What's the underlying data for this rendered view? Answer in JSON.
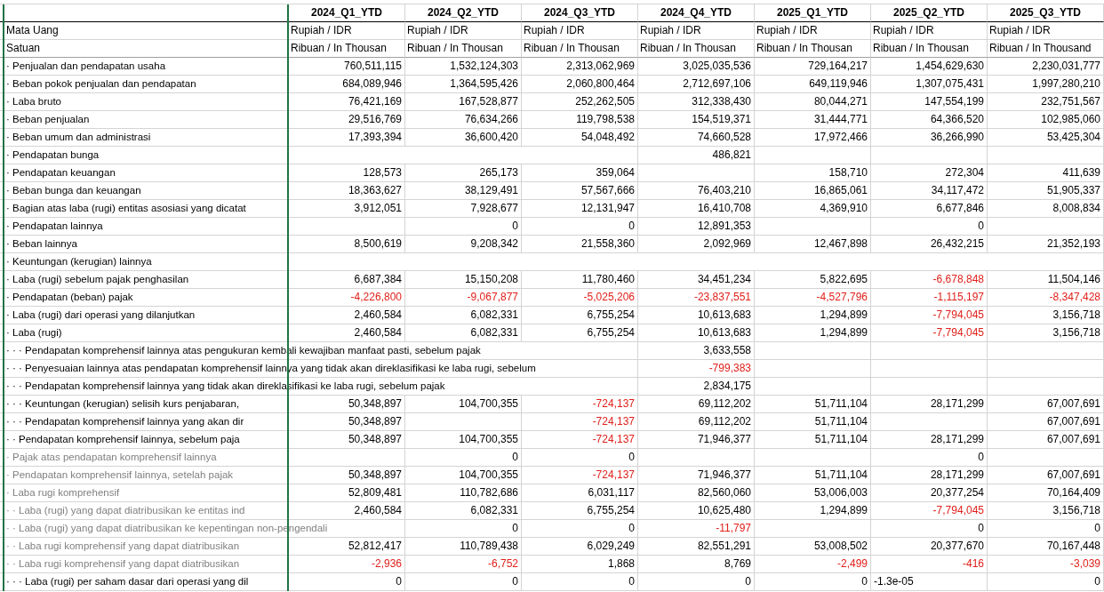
{
  "columns": [
    "2024_Q1_YTD",
    "2024_Q2_YTD",
    "2024_Q3_YTD",
    "2024_Q4_YTD",
    "2025_Q1_YTD",
    "2025_Q2_YTD",
    "2025_Q3_YTD"
  ],
  "currency": {
    "label": "Mata Uang",
    "values": [
      "Rupiah / IDR",
      "Rupiah / IDR",
      "Rupiah / IDR",
      "Rupiah / IDR",
      "Rupiah / IDR",
      "Rupiah / IDR",
      "Rupiah / IDR"
    ]
  },
  "unit": {
    "label": "Satuan",
    "values": [
      "Ribuan / In Thousan",
      "Ribuan / In Thousan",
      "Ribuan / In Thousan",
      "Ribuan / In Thousan",
      "Ribuan / In Thousan",
      "Ribuan / In Thousan",
      "Ribuan / In Thousand"
    ]
  },
  "rows": [
    {
      "label": "· Penjualan dan pendapatan usaha",
      "dimmed": false,
      "cells": [
        {
          "value": "760,511,115",
          "negative": false
        },
        {
          "value": "1,532,124,303",
          "negative": false
        },
        {
          "value": "2,313,062,969",
          "negative": false
        },
        {
          "value": "3,025,035,536",
          "negative": false
        },
        {
          "value": "729,164,217",
          "negative": false
        },
        {
          "value": "1,454,629,630",
          "negative": false
        },
        {
          "value": "2,230,031,777",
          "negative": false
        }
      ]
    },
    {
      "label": "· Beban pokok penjualan dan pendapatan",
      "dimmed": false,
      "cells": [
        {
          "value": "684,089,946",
          "negative": false
        },
        {
          "value": "1,364,595,426",
          "negative": false
        },
        {
          "value": "2,060,800,464",
          "negative": false
        },
        {
          "value": "2,712,697,106",
          "negative": false
        },
        {
          "value": "649,119,946",
          "negative": false
        },
        {
          "value": "1,307,075,431",
          "negative": false
        },
        {
          "value": "1,997,280,210",
          "negative": false
        }
      ]
    },
    {
      "label": "· Laba bruto",
      "dimmed": false,
      "cells": [
        {
          "value": "76,421,169",
          "negative": false
        },
        {
          "value": "167,528,877",
          "negative": false
        },
        {
          "value": "252,262,505",
          "negative": false
        },
        {
          "value": "312,338,430",
          "negative": false
        },
        {
          "value": "80,044,271",
          "negative": false
        },
        {
          "value": "147,554,199",
          "negative": false
        },
        {
          "value": "232,751,567",
          "negative": false
        }
      ]
    },
    {
      "label": "· Beban penjualan",
      "dimmed": false,
      "cells": [
        {
          "value": "29,516,769",
          "negative": false
        },
        {
          "value": "76,634,266",
          "negative": false
        },
        {
          "value": "119,798,538",
          "negative": false
        },
        {
          "value": "154,519,371",
          "negative": false
        },
        {
          "value": "31,444,771",
          "negative": false
        },
        {
          "value": "64,366,520",
          "negative": false
        },
        {
          "value": "102,985,060",
          "negative": false
        }
      ]
    },
    {
      "label": "· Beban umum dan administrasi",
      "dimmed": false,
      "cells": [
        {
          "value": "17,393,394",
          "negative": false
        },
        {
          "value": "36,600,420",
          "negative": false
        },
        {
          "value": "54,048,492",
          "negative": false
        },
        {
          "value": "74,660,528",
          "negative": false
        },
        {
          "value": "17,972,466",
          "negative": false
        },
        {
          "value": "36,266,990",
          "negative": false
        },
        {
          "value": "53,425,304",
          "negative": false
        }
      ]
    },
    {
      "label": "· Pendapatan bunga",
      "dimmed": false,
      "cells": [
        null,
        null,
        null,
        {
          "value": "486,821",
          "negative": false
        },
        null,
        null,
        null
      ]
    },
    {
      "label": "· Pendapatan keuangan",
      "dimmed": false,
      "cells": [
        {
          "value": "128,573",
          "negative": false
        },
        {
          "value": "265,173",
          "negative": false
        },
        {
          "value": "359,064",
          "negative": false
        },
        null,
        {
          "value": "158,710",
          "negative": false
        },
        {
          "value": "272,304",
          "negative": false
        },
        {
          "value": "411,639",
          "negative": false
        }
      ]
    },
    {
      "label": "· Beban bunga dan keuangan",
      "dimmed": false,
      "cells": [
        {
          "value": "18,363,627",
          "negative": false
        },
        {
          "value": "38,129,491",
          "negative": false
        },
        {
          "value": "57,567,666",
          "negative": false
        },
        {
          "value": "76,403,210",
          "negative": false
        },
        {
          "value": "16,865,061",
          "negative": false
        },
        {
          "value": "34,117,472",
          "negative": false
        },
        {
          "value": "51,905,337",
          "negative": false
        }
      ]
    },
    {
      "label": "· Bagian atas laba (rugi) entitas asosiasi yang dicatat",
      "dimmed": false,
      "cells": [
        {
          "value": "3,912,051",
          "negative": false
        },
        {
          "value": "7,928,677",
          "negative": false
        },
        {
          "value": "12,131,947",
          "negative": false
        },
        {
          "value": "16,410,708",
          "negative": false
        },
        {
          "value": "4,369,910",
          "negative": false
        },
        {
          "value": "6,677,846",
          "negative": false
        },
        {
          "value": "8,008,834",
          "negative": false
        }
      ]
    },
    {
      "label": "· Pendapatan lainnya",
      "dimmed": false,
      "cells": [
        null,
        {
          "value": "0",
          "negative": false
        },
        {
          "value": "0",
          "negative": false
        },
        {
          "value": "12,891,353",
          "negative": false
        },
        null,
        {
          "value": "0",
          "negative": false
        },
        null
      ]
    },
    {
      "label": "· Beban lainnya",
      "dimmed": false,
      "cells": [
        {
          "value": "8,500,619",
          "negative": false
        },
        {
          "value": "9,208,342",
          "negative": false
        },
        {
          "value": "21,558,360",
          "negative": false
        },
        {
          "value": "2,092,969",
          "negative": false
        },
        {
          "value": "12,467,898",
          "negative": false
        },
        {
          "value": "26,432,215",
          "negative": false
        },
        {
          "value": "21,352,193",
          "negative": false
        }
      ]
    },
    {
      "label": "· Keuntungan (kerugian) lainnya",
      "dimmed": false,
      "cells": [
        null,
        null,
        null,
        null,
        null,
        null,
        null
      ]
    },
    {
      "label": "· Laba (rugi) sebelum pajak penghasilan",
      "dimmed": false,
      "cells": [
        {
          "value": "6,687,384",
          "negative": false
        },
        {
          "value": "15,150,208",
          "negative": false
        },
        {
          "value": "11,780,460",
          "negative": false
        },
        {
          "value": "34,451,234",
          "negative": false
        },
        {
          "value": "5,822,695",
          "negative": false
        },
        {
          "value": "-6,678,848",
          "negative": true
        },
        {
          "value": "11,504,146",
          "negative": false
        }
      ]
    },
    {
      "label": "· Pendapatan (beban) pajak",
      "dimmed": false,
      "cells": [
        {
          "value": "-4,226,800",
          "negative": true
        },
        {
          "value": "-9,067,877",
          "negative": true
        },
        {
          "value": "-5,025,206",
          "negative": true
        },
        {
          "value": "-23,837,551",
          "negative": true
        },
        {
          "value": "-4,527,796",
          "negative": true
        },
        {
          "value": "-1,115,197",
          "negative": true
        },
        {
          "value": "-8,347,428",
          "negative": true
        }
      ]
    },
    {
      "label": "· Laba (rugi) dari operasi yang dilanjutkan",
      "dimmed": false,
      "cells": [
        {
          "value": "2,460,584",
          "negative": false
        },
        {
          "value": "6,082,331",
          "negative": false
        },
        {
          "value": "6,755,254",
          "negative": false
        },
        {
          "value": "10,613,683",
          "negative": false
        },
        {
          "value": "1,294,899",
          "negative": false
        },
        {
          "value": "-7,794,045",
          "negative": true
        },
        {
          "value": "3,156,718",
          "negative": false
        }
      ]
    },
    {
      "label": "· Laba (rugi)",
      "dimmed": false,
      "cells": [
        {
          "value": "2,460,584",
          "negative": false
        },
        {
          "value": "6,082,331",
          "negative": false
        },
        {
          "value": "6,755,254",
          "negative": false
        },
        {
          "value": "10,613,683",
          "negative": false
        },
        {
          "value": "1,294,899",
          "negative": false
        },
        {
          "value": "-7,794,045",
          "negative": true
        },
        {
          "value": "3,156,718",
          "negative": false
        }
      ]
    },
    {
      "label": "· · · Pendapatan komprehensif lainnya atas pengukuran kembali kewajiban manfaat pasti, sebelum pajak",
      "dimmed": false,
      "cells": [
        null,
        null,
        null,
        {
          "value": "3,633,558",
          "negative": false
        },
        null,
        null,
        null
      ]
    },
    {
      "label": "· · · Penyesuaian lainnya atas pendapatan komprehensif lainnya yang tidak akan direklasifikasi ke laba rugi, sebelum",
      "dimmed": false,
      "cells": [
        null,
        null,
        null,
        {
          "value": "-799,383",
          "negative": true
        },
        null,
        null,
        null
      ]
    },
    {
      "label": "· · · Pendapatan komprehensif lainnya yang tidak akan direklasifikasi ke laba rugi, sebelum pajak",
      "dimmed": false,
      "cells": [
        null,
        null,
        null,
        {
          "value": "2,834,175",
          "negative": false
        },
        null,
        null,
        null
      ]
    },
    {
      "label": "· · · Keuntungan (kerugian) selisih kurs penjabaran,",
      "dimmed": false,
      "cells": [
        {
          "value": "50,348,897",
          "negative": false
        },
        {
          "value": "104,700,355",
          "negative": false
        },
        {
          "value": "-724,137",
          "negative": true
        },
        {
          "value": "69,112,202",
          "negative": false
        },
        {
          "value": "51,711,104",
          "negative": false
        },
        {
          "value": "28,171,299",
          "negative": false
        },
        {
          "value": "67,007,691",
          "negative": false
        }
      ]
    },
    {
      "label": "· · · Pendapatan komprehensif lainnya yang akan dir",
      "dimmed": false,
      "cells": [
        {
          "value": "50,348,897",
          "negative": false
        },
        null,
        {
          "value": "-724,137",
          "negative": true
        },
        {
          "value": "69,112,202",
          "negative": false
        },
        {
          "value": "51,711,104",
          "negative": false
        },
        null,
        {
          "value": "67,007,691",
          "negative": false
        }
      ]
    },
    {
      "label": "· · Pendapatan komprehensif lainnya, sebelum paja",
      "dimmed": false,
      "cells": [
        {
          "value": "50,348,897",
          "negative": false
        },
        {
          "value": "104,700,355",
          "negative": false
        },
        {
          "value": "-724,137",
          "negative": true
        },
        {
          "value": "71,946,377",
          "negative": false
        },
        {
          "value": "51,711,104",
          "negative": false
        },
        {
          "value": "28,171,299",
          "negative": false
        },
        {
          "value": "67,007,691",
          "negative": false
        }
      ]
    },
    {
      "label": "· Pajak atas pendapatan komprehensif lainnya",
      "dimmed": true,
      "cells": [
        null,
        {
          "value": "0",
          "negative": false
        },
        {
          "value": "0",
          "negative": false
        },
        null,
        null,
        {
          "value": "0",
          "negative": false
        },
        null
      ]
    },
    {
      "label": "· Pendapatan komprehensif lainnya, setelah pajak",
      "dimmed": true,
      "cells": [
        {
          "value": "50,348,897",
          "negative": false
        },
        {
          "value": "104,700,355",
          "negative": false
        },
        {
          "value": "-724,137",
          "negative": true
        },
        {
          "value": "71,946,377",
          "negative": false
        },
        {
          "value": "51,711,104",
          "negative": false
        },
        {
          "value": "28,171,299",
          "negative": false
        },
        {
          "value": "67,007,691",
          "negative": false
        }
      ]
    },
    {
      "label": "· Laba rugi komprehensif",
      "dimmed": true,
      "cells": [
        {
          "value": "52,809,481",
          "negative": false
        },
        {
          "value": "110,782,686",
          "negative": false
        },
        {
          "value": "6,031,117",
          "negative": false
        },
        {
          "value": "82,560,060",
          "negative": false
        },
        {
          "value": "53,006,003",
          "negative": false
        },
        {
          "value": "20,377,254",
          "negative": false
        },
        {
          "value": "70,164,409",
          "negative": false
        }
      ]
    },
    {
      "label": "· · Laba (rugi) yang dapat diatribusikan ke entitas ind",
      "dimmed": true,
      "cells": [
        {
          "value": "2,460,584",
          "negative": false
        },
        {
          "value": "6,082,331",
          "negative": false
        },
        {
          "value": "6,755,254",
          "negative": false
        },
        {
          "value": "10,625,480",
          "negative": false
        },
        {
          "value": "1,294,899",
          "negative": false
        },
        {
          "value": "-7,794,045",
          "negative": true
        },
        {
          "value": "3,156,718",
          "negative": false
        }
      ]
    },
    {
      "label": "· · Laba (rugi) yang dapat diatribusikan ke kepentingan non-pengendali",
      "dimmed": true,
      "cells": [
        null,
        {
          "value": "0",
          "negative": false
        },
        {
          "value": "0",
          "negative": false
        },
        {
          "value": "-11,797",
          "negative": true
        },
        null,
        {
          "value": "0",
          "negative": false
        },
        {
          "value": "0",
          "negative": false
        }
      ]
    },
    {
      "label": "· · Laba rugi komprehensif yang dapat diatribusikan",
      "dimmed": true,
      "cells": [
        {
          "value": "52,812,417",
          "negative": false
        },
        {
          "value": "110,789,438",
          "negative": false
        },
        {
          "value": "6,029,249",
          "negative": false
        },
        {
          "value": "82,551,291",
          "negative": false
        },
        {
          "value": "53,008,502",
          "negative": false
        },
        {
          "value": "20,377,670",
          "negative": false
        },
        {
          "value": "70,167,448",
          "negative": false
        }
      ]
    },
    {
      "label": "· · Laba rugi komprehensif yang dapat diatribusikan",
      "dimmed": true,
      "cells": [
        {
          "value": "-2,936",
          "negative": true
        },
        {
          "value": "-6,752",
          "negative": true
        },
        {
          "value": "1,868",
          "negative": false
        },
        {
          "value": "8,769",
          "negative": false
        },
        {
          "value": "-2,499",
          "negative": true
        },
        {
          "value": "-416",
          "negative": true
        },
        {
          "value": "-3,039",
          "negative": true
        }
      ]
    },
    {
      "label": "· · · Laba (rugi) per saham dasar dari operasi yang dil",
      "dimmed": false,
      "cells": [
        {
          "value": "0",
          "negative": false
        },
        {
          "value": "0",
          "negative": false
        },
        {
          "value": "0",
          "negative": false
        },
        {
          "value": "0",
          "negative": false
        },
        {
          "value": "0",
          "negative": false
        },
        {
          "value": "-1.3e-05",
          "negative": false,
          "left_aligned": true
        },
        {
          "value": "0",
          "negative": false
        }
      ]
    }
  ]
}
